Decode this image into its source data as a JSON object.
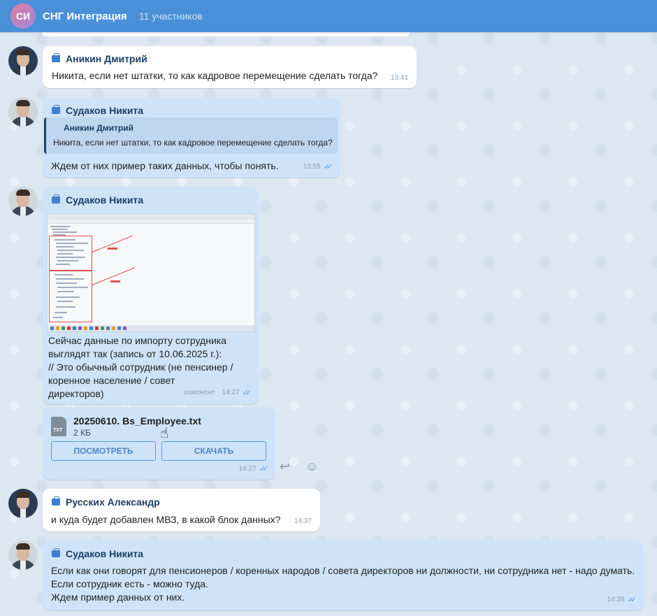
{
  "header": {
    "avatar_initials": "СИ",
    "title": "СНГ Интеграция",
    "members": "11 участников"
  },
  "messages": [
    {
      "sender": "Аникин Дмитрий",
      "text": "Никита, если нет штатки, то как кадровое перемещение сделать тогда?",
      "time": "13:41"
    },
    {
      "sender": "Судаков Никита",
      "reply_sender": "Аникин Дмитрий",
      "reply_text": "Никита, если нет штатки, то как кадровое перемещение сделать тогда?",
      "text": "Ждем от них пример таких данных, чтобы понять.",
      "time": "13:55"
    },
    {
      "sender": "Судаков Никита",
      "text_lines": [
        "Сейчас данные по импорту сотрудника",
        "выглядят так (запись от 10.06.2025 г.):",
        "// Это обычный сотрудник (не пенсинер /",
        "коренное население / совет",
        "директоров)"
      ],
      "edited": "изменено",
      "time": "14:27"
    },
    {
      "file_name": "20250610. Bs_Employee.txt",
      "file_size": "2 КБ",
      "file_ext": "TXT",
      "view_button": "ПОСМОТРЕТЬ",
      "download_button": "СКАЧАТЬ",
      "time": "14:27"
    },
    {
      "sender": "Русских Александр",
      "text": "и куда будет добавлен МВЗ, в какой блок данных?",
      "time": "14:37"
    },
    {
      "sender": "Судаков Никита",
      "text_lines": [
        "Если как они говорят для пенсионеров / коренных народов / совета директоров ни должности, ни сотрудника нет - надо думать.",
        "Если сотрудник есть - можно туда.",
        "Ждем пример данных от них."
      ],
      "time": "14:38"
    }
  ],
  "icons": {
    "reply": "reply-icon",
    "emoji": "emoji-icon",
    "read_check": "double-check-icon"
  },
  "colors": {
    "header": "#4a90d9",
    "own_bubble": "#cfe3f8",
    "other_bubble": "#ffffff"
  }
}
